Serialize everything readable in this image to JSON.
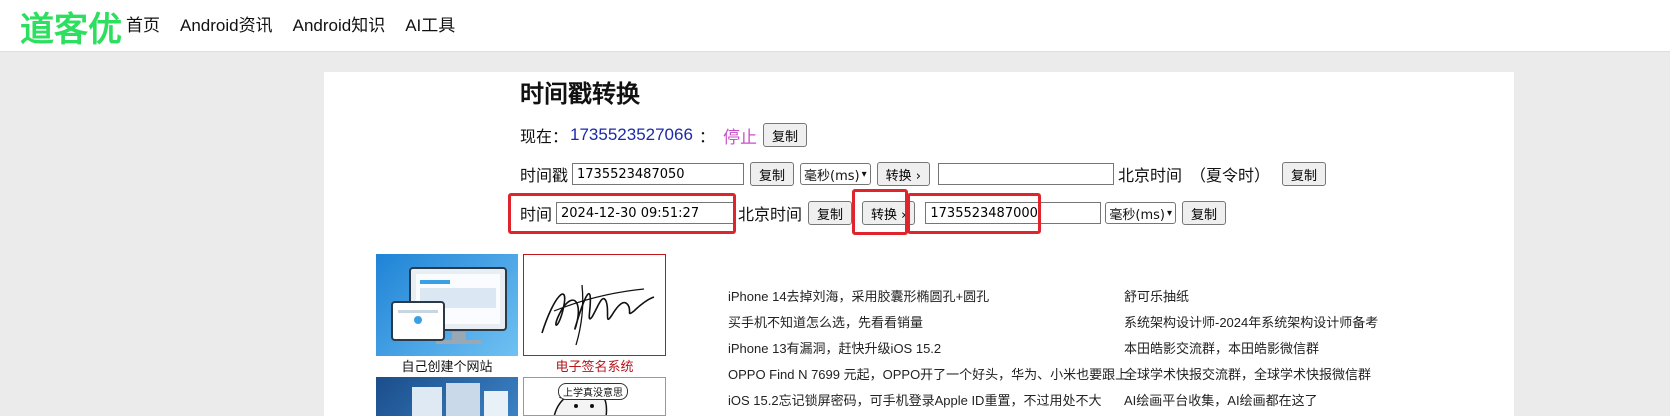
{
  "header": {
    "logo": "道客优",
    "nav": [
      "首页",
      "Android资讯",
      "Android知识",
      "AI工具"
    ]
  },
  "page": {
    "title": "时间戳转换"
  },
  "now_row": {
    "label": "现在：",
    "timestamp": "1735523527066",
    "colon": "：",
    "stop_label": "停止",
    "copy_label": "复制"
  },
  "ts_row": {
    "label": "时间戳",
    "input_value": "1735523487050",
    "copy_label": "复制",
    "unit_selected": "毫秒(ms)",
    "convert_label": "转换 ›",
    "output_value": "",
    "tz_label": "北京时间",
    "dst_label": "（夏令时）",
    "copy2_label": "复制"
  },
  "time_row": {
    "label": "时间",
    "input_value": "2024-12-30 09:51:27",
    "tz_label": "北京时间",
    "copy_label": "复制",
    "convert_label": "转换 ›",
    "output_value": "1735523487000",
    "unit_selected": "毫秒(ms)",
    "copy2_label": "复制"
  },
  "thumbs": [
    {
      "caption": "自己创建个网站",
      "caption_color": "#111111"
    },
    {
      "caption": "电子签名系统",
      "caption_color": "#b8141b"
    }
  ],
  "thumb_bubble": "上学真没意思",
  "news_left": [
    "iPhone 14去掉刘海，采用胶囊形椭圆孔+圆孔",
    "买手机不知道怎么选，先看看销量",
    "iPhone 13有漏洞，赶快升级iOS 15.2",
    "OPPO Find N 7699 元起，OPPO开了一个好头，华为、小米也要跟上",
    "iOS 15.2忘记锁屏密码，可手机登录Apple ID重置，不过用处不大"
  ],
  "news_right": [
    "舒可乐抽纸",
    "系统架构设计师-2024年系统架构设计师备考",
    "本田皓影交流群，本田皓影微信群",
    "全球学术快报交流群，全球学术快报微信群",
    "AI绘画平台收集，AI绘画都在这了"
  ],
  "colors": {
    "brand": "#2ddf5e",
    "timestamp": "#1c2aa8",
    "stop": "#c94ec9",
    "highlight": "#e0242c"
  }
}
